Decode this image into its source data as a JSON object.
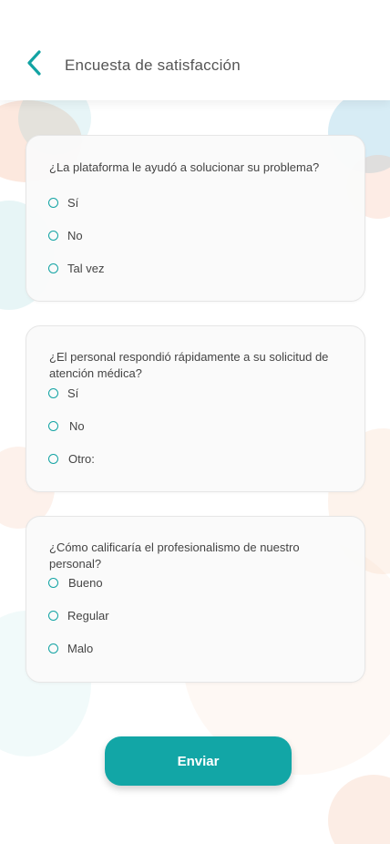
{
  "header": {
    "title": "Encuesta de satisfacción"
  },
  "survey": {
    "q1": {
      "question": "¿La plataforma le ayudó a solucionar su problema?",
      "options": [
        "Sí",
        "No",
        "Tal vez"
      ]
    },
    "q2": {
      "question": "¿El personal respondió rápidamente a su solicitud de atención médica?",
      "options": [
        "Sí",
        "No",
        "Otro:"
      ]
    },
    "q3": {
      "question": "¿Cómo calificaría el profesionalismo de nuestro personal?",
      "options": [
        "Bueno",
        "Regular",
        "Malo"
      ]
    }
  },
  "submit_label": "Enviar",
  "colors": {
    "accent": "#12a6a6",
    "radio": "#12a3a3"
  },
  "icons": {
    "back": "chevron-left-icon"
  }
}
